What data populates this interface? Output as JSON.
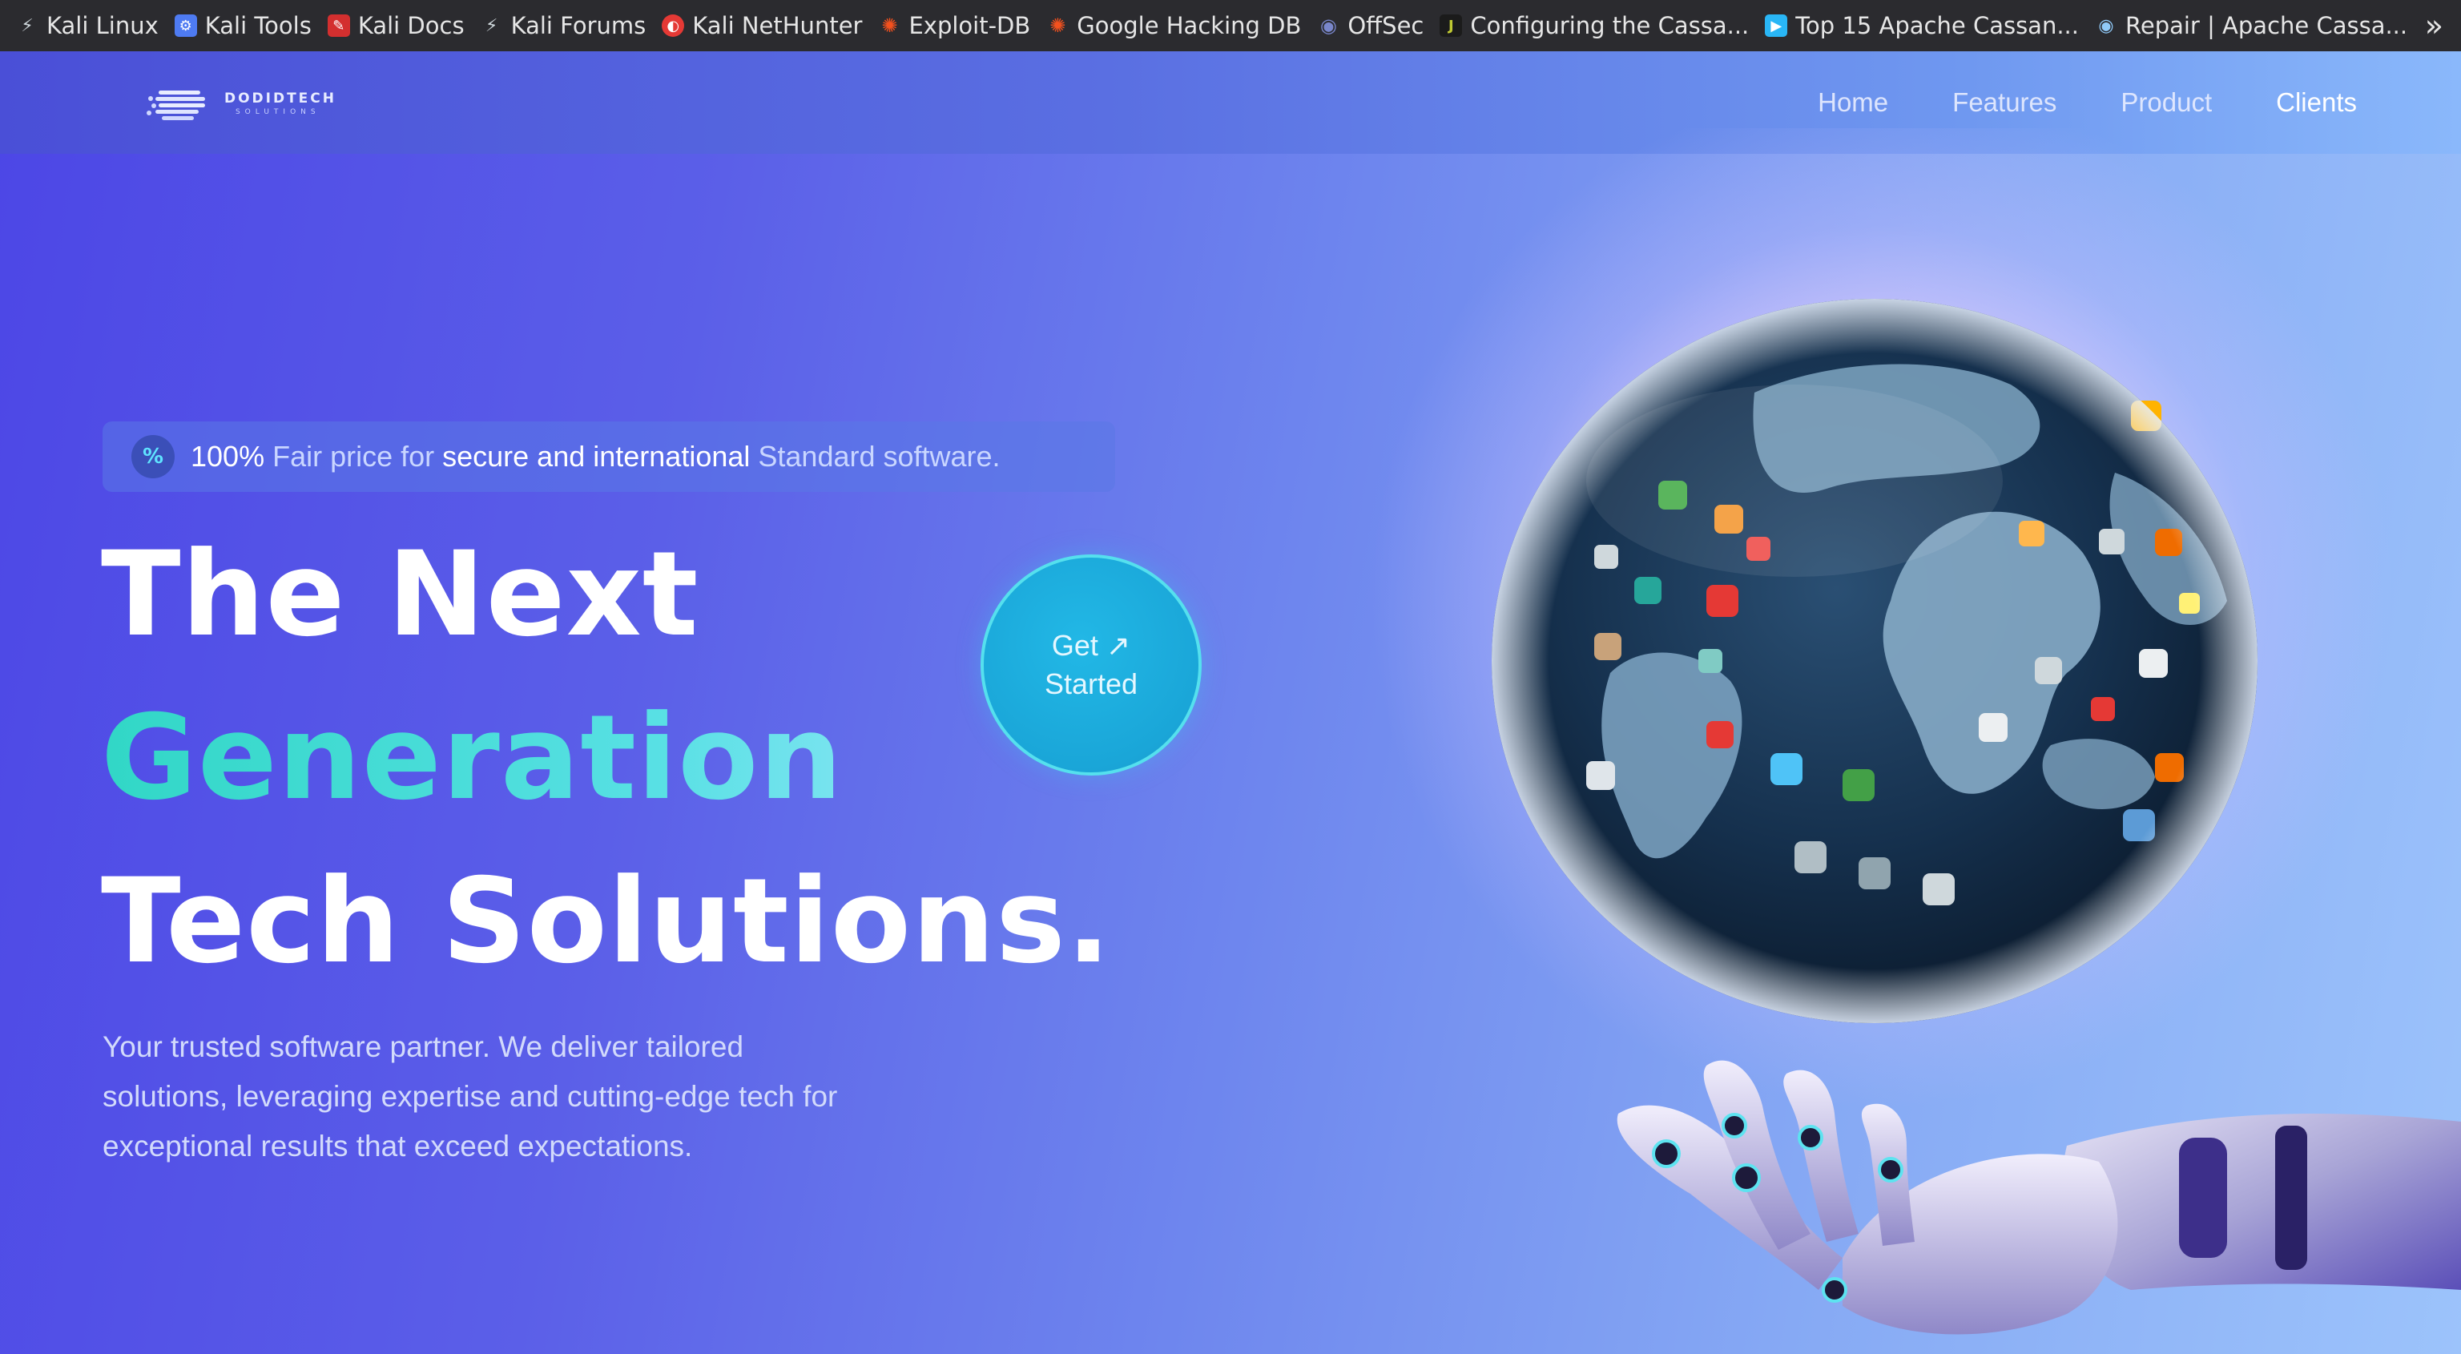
{
  "bookmarks": [
    {
      "label": "Kali Linux",
      "icon": "kali-dragon-icon",
      "color": "#cfd8dc"
    },
    {
      "label": "Kali Tools",
      "icon": "kali-tools-icon",
      "color": "#4e7bf2"
    },
    {
      "label": "Kali Docs",
      "icon": "kali-docs-icon",
      "color": "#d32f2f"
    },
    {
      "label": "Kali Forums",
      "icon": "kali-forums-icon",
      "color": "#cfd8dc"
    },
    {
      "label": "Kali NetHunter",
      "icon": "nethunter-icon",
      "color": "#e53935"
    },
    {
      "label": "Exploit-DB",
      "icon": "exploit-db-icon",
      "color": "#f4511e"
    },
    {
      "label": "Google Hacking DB",
      "icon": "ghdb-icon",
      "color": "#f4511e"
    },
    {
      "label": "OffSec",
      "icon": "offsec-icon",
      "color": "#5c6bc0"
    },
    {
      "label": "Configuring the Cassa...",
      "icon": "j-icon",
      "color": "#c0ca33"
    },
    {
      "label": "Top 15 Apache Cassan...",
      "icon": "cassandra-icon",
      "color": "#29b6f6"
    },
    {
      "label": "Repair | Apache Cassa...",
      "icon": "cassandra-eye-icon",
      "color": "#90caf9"
    }
  ],
  "bookmarks_more_icon": "double-chevron-right-icon",
  "logo": {
    "name": "DODIDTECH",
    "sub": "SOLUTIONS"
  },
  "nav": [
    {
      "label": "Home"
    },
    {
      "label": "Features"
    },
    {
      "label": "Product"
    },
    {
      "label": "Clients"
    }
  ],
  "badge": {
    "icon": "percent-icon",
    "parts": [
      "100%",
      " Fair price for ",
      "secure and international",
      " Standard software."
    ]
  },
  "headline": [
    "The Next",
    "Generation",
    "Tech Solutions."
  ],
  "lead": "Your trusted software partner. We deliver tailored solutions, leveraging expertise and cutting-edge tech for exceptional results that exceed expectations.",
  "cta": {
    "line1": "Get ↗",
    "line2": "Started"
  },
  "colors": {
    "accent": "#31d7c6",
    "cta": "#1ba7d8",
    "bookmark_bar": "#2b2b2f"
  }
}
